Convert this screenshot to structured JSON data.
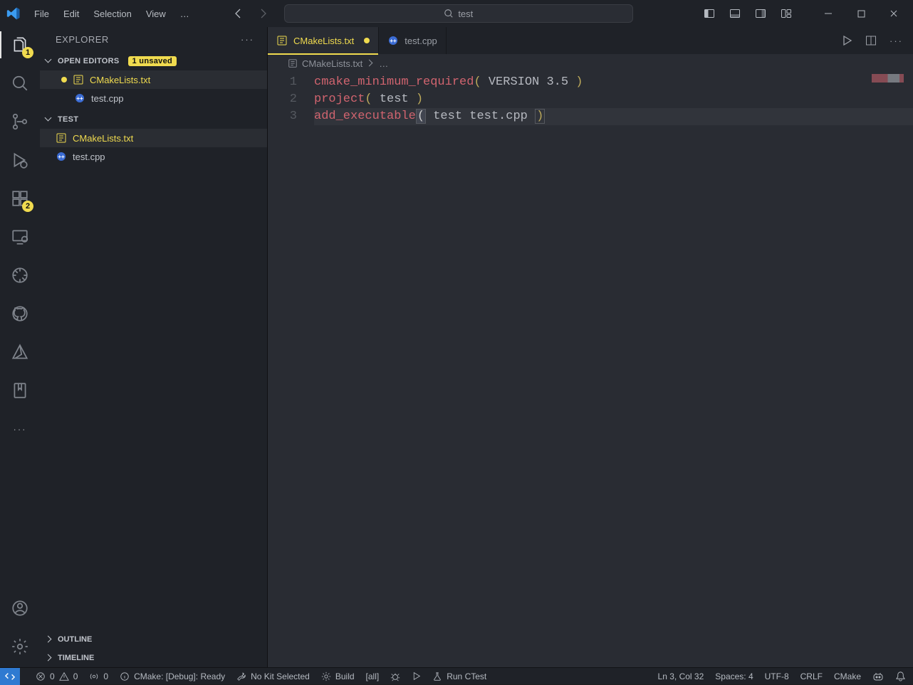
{
  "menu": {
    "file": "File",
    "edit": "Edit",
    "selection": "Selection",
    "view": "View",
    "more": "…"
  },
  "search_text": "test",
  "activity_badges": {
    "explorer": "1",
    "extensions": "2"
  },
  "sidebar": {
    "title": "EXPLORER",
    "open_editors_label": "OPEN EDITORS",
    "unsaved_badge": "1 unsaved",
    "open_editors": [
      {
        "name": "CMakeLists.txt",
        "dirty": true,
        "active": true
      },
      {
        "name": "test.cpp",
        "dirty": false,
        "active": false
      }
    ],
    "workspace_label": "TEST",
    "workspace_files": [
      {
        "name": "CMakeLists.txt",
        "active": true
      },
      {
        "name": "test.cpp",
        "active": false
      }
    ],
    "outline_label": "OUTLINE",
    "timeline_label": "TIMELINE"
  },
  "tabs": [
    {
      "name": "CMakeLists.txt",
      "dirty": true,
      "active": true,
      "icon": "list"
    },
    {
      "name": "test.cpp",
      "dirty": false,
      "active": false,
      "icon": "cpp"
    }
  ],
  "breadcrumb": {
    "file": "CMakeLists.txt",
    "more": "…"
  },
  "code": {
    "lines": [
      {
        "n": "1",
        "segments": [
          {
            "t": "cmake_minimum_required",
            "c": "fn"
          },
          {
            "t": "(",
            "c": "paren"
          },
          {
            "t": " VERSION 3.5 ",
            "c": "kw"
          },
          {
            "t": ")",
            "c": "paren"
          }
        ]
      },
      {
        "n": "2",
        "segments": [
          {
            "t": "project",
            "c": "fn"
          },
          {
            "t": "(",
            "c": "paren"
          },
          {
            "t": " test ",
            "c": "kw"
          },
          {
            "t": ")",
            "c": "paren"
          }
        ]
      },
      {
        "n": "3",
        "segments": [
          {
            "t": "add_executable",
            "c": "fn"
          },
          {
            "t": "(",
            "c": "paren-hl"
          },
          {
            "t": " test test.cpp ",
            "c": "text"
          },
          {
            "t": ")",
            "c": "cursor-box"
          }
        ],
        "hl": true
      }
    ]
  },
  "status": {
    "errors": "0",
    "warnings": "0",
    "ports": "0",
    "cmake": "CMake: [Debug]: Ready",
    "kit": "No Kit Selected",
    "build": "Build",
    "target": "[all]",
    "ctest": "Run CTest",
    "lncol": "Ln 3, Col 32",
    "spaces": "Spaces: 4",
    "encoding": "UTF-8",
    "eol": "CRLF",
    "lang": "CMake"
  }
}
